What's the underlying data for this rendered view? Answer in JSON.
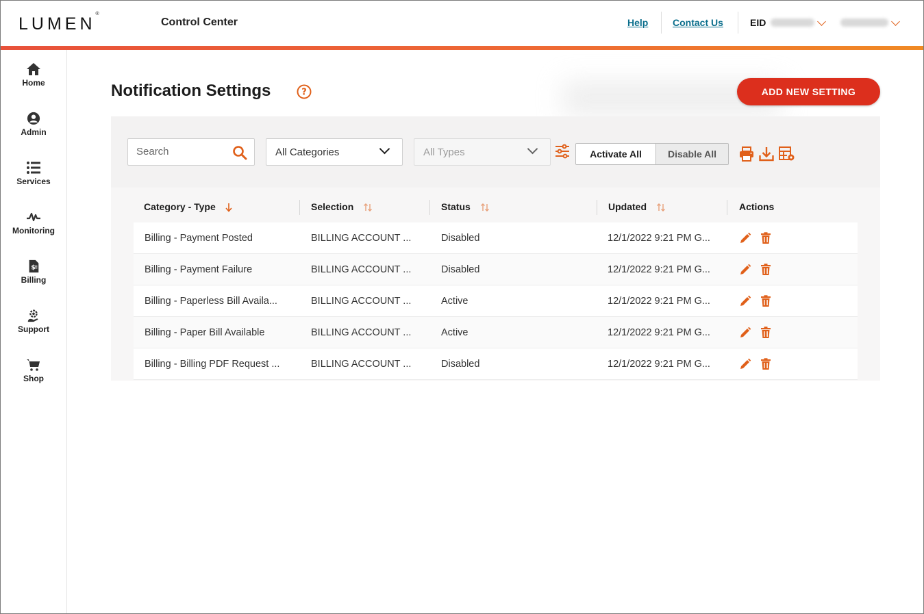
{
  "header": {
    "brand": "LUMEN",
    "brand_mark": "®",
    "app_title": "Control Center",
    "links": {
      "help": "Help",
      "contact": "Contact Us"
    },
    "eid_label": "EID"
  },
  "sidebar": {
    "items": [
      {
        "label": "Home",
        "icon": "home-icon"
      },
      {
        "label": "Admin",
        "icon": "user-icon"
      },
      {
        "label": "Services",
        "icon": "list-icon"
      },
      {
        "label": "Monitoring",
        "icon": "pulse-icon"
      },
      {
        "label": "Billing",
        "icon": "invoice-icon"
      },
      {
        "label": "Support",
        "icon": "support-icon"
      },
      {
        "label": "Shop",
        "icon": "cart-icon"
      }
    ]
  },
  "page": {
    "title": "Notification Settings",
    "add_button": "ADD NEW SETTING"
  },
  "toolbar": {
    "search_placeholder": "Search",
    "category_select": "All Categories",
    "type_select": "All Types",
    "activate_all": "Activate All",
    "disable_all": "Disable All"
  },
  "table": {
    "columns": [
      "Category - Type",
      "Selection",
      "Status",
      "Updated",
      "Actions"
    ],
    "rows": [
      {
        "category": "Billing - Payment Posted",
        "selection": "BILLING ACCOUNT ...",
        "status": "Disabled",
        "updated": "12/1/2022 9:21 PM G..."
      },
      {
        "category": "Billing - Payment Failure",
        "selection": "BILLING ACCOUNT ...",
        "status": "Disabled",
        "updated": "12/1/2022 9:21 PM G..."
      },
      {
        "category": "Billing - Paperless Bill Availa...",
        "selection": "BILLING ACCOUNT ...",
        "status": "Active",
        "updated": "12/1/2022 9:21 PM G..."
      },
      {
        "category": "Billing - Paper Bill Available",
        "selection": "BILLING ACCOUNT ...",
        "status": "Active",
        "updated": "12/1/2022 9:21 PM G..."
      },
      {
        "category": "Billing - Billing PDF Request ...",
        "selection": "BILLING ACCOUNT ...",
        "status": "Disabled",
        "updated": "12/1/2022 9:21 PM G..."
      }
    ]
  },
  "colors": {
    "accent_orange": "#e0601a",
    "primary_red": "#dc2f1d",
    "link_teal": "#0a6e8c"
  }
}
